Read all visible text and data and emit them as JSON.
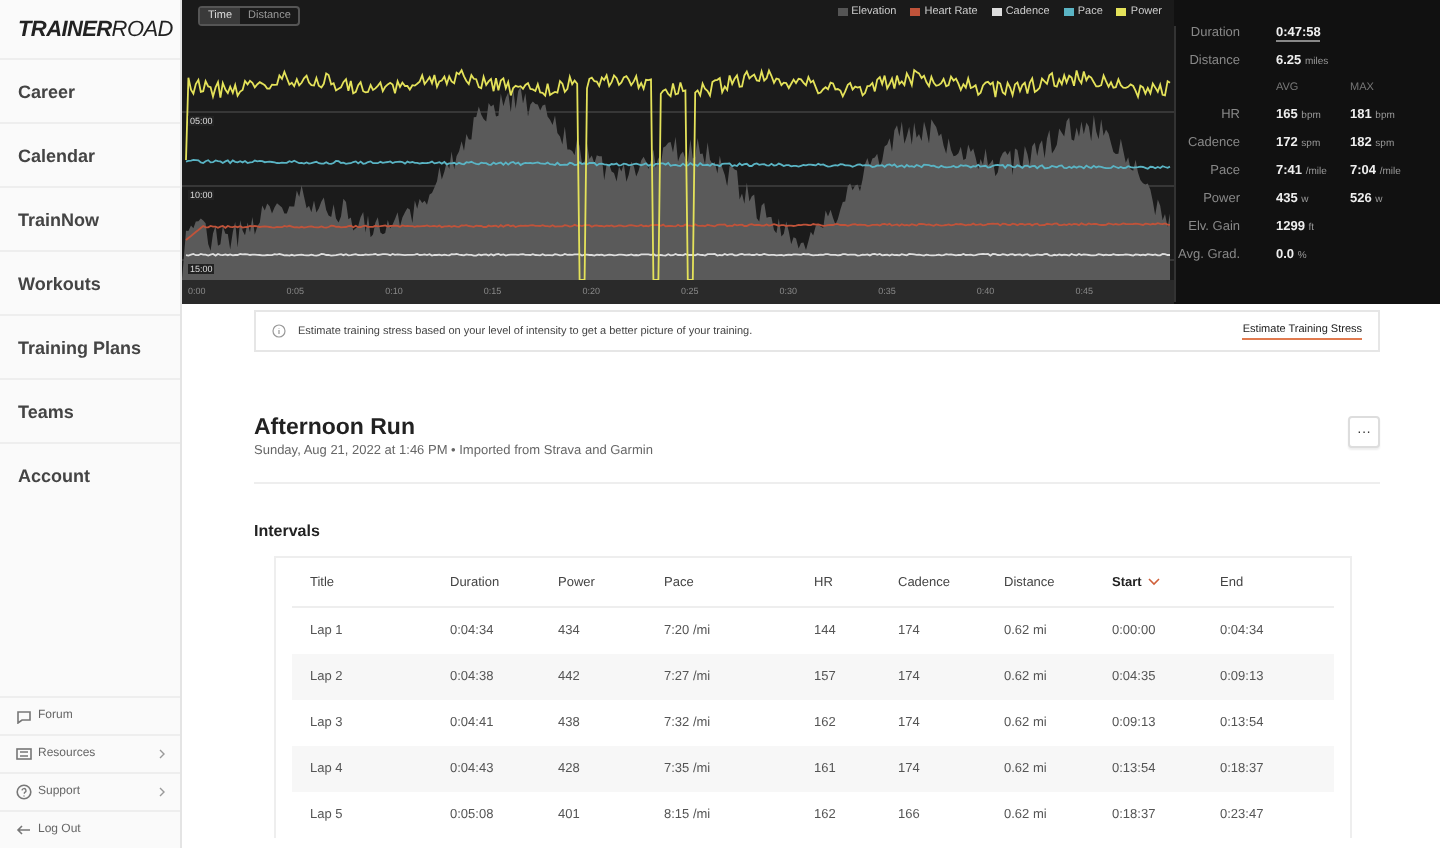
{
  "sidebar": {
    "logo_bold": "TRAINER",
    "logo_light": "ROAD",
    "items": [
      {
        "label": "Career"
      },
      {
        "label": "Calendar"
      },
      {
        "label": "TrainNow"
      },
      {
        "label": "Workouts"
      },
      {
        "label": "Training Plans"
      },
      {
        "label": "Teams"
      },
      {
        "label": "Account"
      }
    ],
    "footer_items": [
      {
        "kind": "forum",
        "label": "Forum",
        "expandable": false
      },
      {
        "kind": "resources",
        "label": "Resources",
        "expandable": true
      },
      {
        "kind": "support",
        "label": "Support",
        "expandable": true
      },
      {
        "kind": "logout",
        "label": "Log Out",
        "expandable": false
      }
    ]
  },
  "chart": {
    "toggle": [
      {
        "label": "Time",
        "selected": true
      },
      {
        "label": "Distance",
        "selected": false
      }
    ],
    "legend": [
      {
        "label": "Elevation",
        "color": "#555555"
      },
      {
        "label": "Heart Rate",
        "color": "#c0533a"
      },
      {
        "label": "Cadence",
        "color": "#dddddd"
      },
      {
        "label": "Pace",
        "color": "#5ab4c4"
      },
      {
        "label": "Power",
        "color": "#e4e25a"
      }
    ],
    "y_ticks": [
      "05:00",
      "10:00",
      "15:00"
    ],
    "x_ticks": [
      "0:00",
      "0:05",
      "0:10",
      "0:15",
      "0:20",
      "0:25",
      "0:30",
      "0:35",
      "0:40",
      "0:45"
    ]
  },
  "stats": {
    "summary": [
      {
        "label": "Duration",
        "value": "0:47:58"
      },
      {
        "label": "Distance",
        "value": "6.25",
        "unit": "miles"
      }
    ],
    "columns": [
      "AVG",
      "MAX"
    ],
    "rows": [
      {
        "label": "HR",
        "avg": "165",
        "avg_unit": "bpm",
        "max": "181",
        "max_unit": "bpm"
      },
      {
        "label": "Cadence",
        "avg": "172",
        "avg_unit": "spm",
        "max": "182",
        "max_unit": "spm"
      },
      {
        "label": "Pace",
        "avg": "7:41",
        "avg_unit": "/mile",
        "max": "7:04",
        "max_unit": "/mile"
      },
      {
        "label": "Power",
        "avg": "435",
        "avg_unit": "w",
        "max": "526",
        "max_unit": "w"
      },
      {
        "label": "Elv. Gain",
        "avg": "1299",
        "avg_unit": "ft"
      },
      {
        "label": "Avg. Grad.",
        "avg": "0.0",
        "avg_unit": "%"
      }
    ]
  },
  "notice": {
    "text": "Estimate training stress based on your level of intensity to get a better picture of your training.",
    "link": "Estimate Training Stress"
  },
  "activity": {
    "title": "Afternoon Run",
    "subtitle": "Sunday, Aug 21, 2022 at 1:46 PM • Imported from Strava and Garmin",
    "menu": "···"
  },
  "intervals": {
    "heading": "Intervals",
    "columns": [
      {
        "label": "Title",
        "sorted": false
      },
      {
        "label": "Duration",
        "sorted": false
      },
      {
        "label": "Power",
        "sorted": false
      },
      {
        "label": "Pace",
        "sorted": false
      },
      {
        "label": "HR",
        "sorted": false
      },
      {
        "label": "Cadence",
        "sorted": false
      },
      {
        "label": "Distance",
        "sorted": false
      },
      {
        "label": "Start",
        "sorted": true
      },
      {
        "label": "End",
        "sorted": false
      }
    ],
    "rows": [
      [
        "Lap 1",
        "0:04:34",
        "434",
        "7:20 /mi",
        "144",
        "174",
        "0.62 mi",
        "0:00:00",
        "0:04:34"
      ],
      [
        "Lap 2",
        "0:04:38",
        "442",
        "7:27 /mi",
        "157",
        "174",
        "0.62 mi",
        "0:04:35",
        "0:09:13"
      ],
      [
        "Lap 3",
        "0:04:41",
        "438",
        "7:32 /mi",
        "162",
        "174",
        "0.62 mi",
        "0:09:13",
        "0:13:54"
      ],
      [
        "Lap 4",
        "0:04:43",
        "428",
        "7:35 /mi",
        "161",
        "174",
        "0.62 mi",
        "0:13:54",
        "0:18:37"
      ],
      [
        "Lap 5",
        "0:05:08",
        "401",
        "8:15 /mi",
        "162",
        "166",
        "0.62 mi",
        "0:18:37",
        "0:23:47"
      ]
    ]
  }
}
